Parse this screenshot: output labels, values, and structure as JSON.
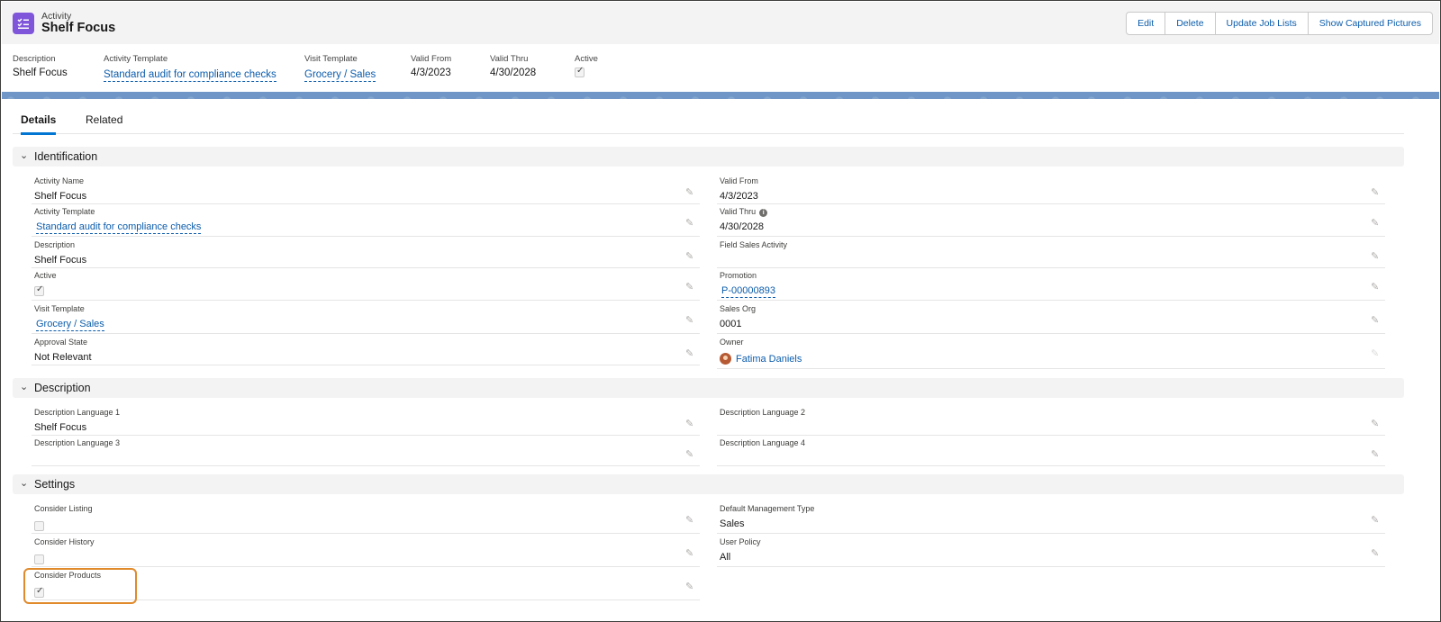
{
  "header": {
    "object_type": "Activity",
    "title": "Shelf Focus",
    "icon": "activity-checklist-icon",
    "icon_color": "#7f56d9",
    "buttons": [
      "Edit",
      "Delete",
      "Update Job Lists",
      "Show Captured Pictures"
    ]
  },
  "highlights": {
    "description": {
      "label": "Description",
      "value": "Shelf Focus"
    },
    "activity_template": {
      "label": "Activity Template",
      "value": "Standard audit for compliance checks"
    },
    "visit_template": {
      "label": "Visit Template",
      "value": "Grocery / Sales"
    },
    "valid_from": {
      "label": "Valid From",
      "value": "4/3/2023"
    },
    "valid_thru": {
      "label": "Valid Thru",
      "value": "4/30/2028"
    },
    "active": {
      "label": "Active",
      "checked": true
    }
  },
  "tabs": [
    "Details",
    "Related"
  ],
  "sections": {
    "identification": {
      "title": "Identification",
      "left": [
        {
          "label": "Activity Name",
          "value": "Shelf Focus"
        },
        {
          "label": "Activity Template",
          "value": "Standard audit for compliance checks"
        },
        {
          "label": "Description",
          "value": "Shelf Focus"
        },
        {
          "label": "Active",
          "checked": true
        },
        {
          "label": "Visit Template",
          "value": "Grocery / Sales"
        },
        {
          "label": "Approval State",
          "value": "Not Relevant"
        }
      ],
      "right": [
        {
          "label": "Valid From",
          "value": "4/3/2023"
        },
        {
          "label": "Valid Thru",
          "value": "4/30/2028"
        },
        {
          "label": "Field Sales Activity",
          "value": ""
        },
        {
          "label": "Promotion",
          "value": "P-00000893"
        },
        {
          "label": "Sales Org",
          "value": "0001"
        },
        {
          "label": "Owner",
          "value": "Fatima Daniels"
        }
      ]
    },
    "description": {
      "title": "Description",
      "left": [
        {
          "label": "Description Language 1",
          "value": "Shelf Focus"
        },
        {
          "label": "Description Language 3",
          "value": ""
        }
      ],
      "right": [
        {
          "label": "Description Language 2",
          "value": ""
        },
        {
          "label": "Description Language 4",
          "value": ""
        }
      ]
    },
    "settings": {
      "title": "Settings",
      "left": [
        {
          "label": "Consider Listing",
          "checked": false
        },
        {
          "label": "Consider History",
          "checked": false
        },
        {
          "label": "Consider Products",
          "checked": true
        }
      ],
      "right": [
        {
          "label": "Default Management Type",
          "value": "Sales"
        },
        {
          "label": "User Policy",
          "value": "All"
        }
      ]
    }
  },
  "colors": {
    "link": "#0b5cab",
    "highlight": "#e08a2c",
    "banner": "#6f96c6"
  }
}
